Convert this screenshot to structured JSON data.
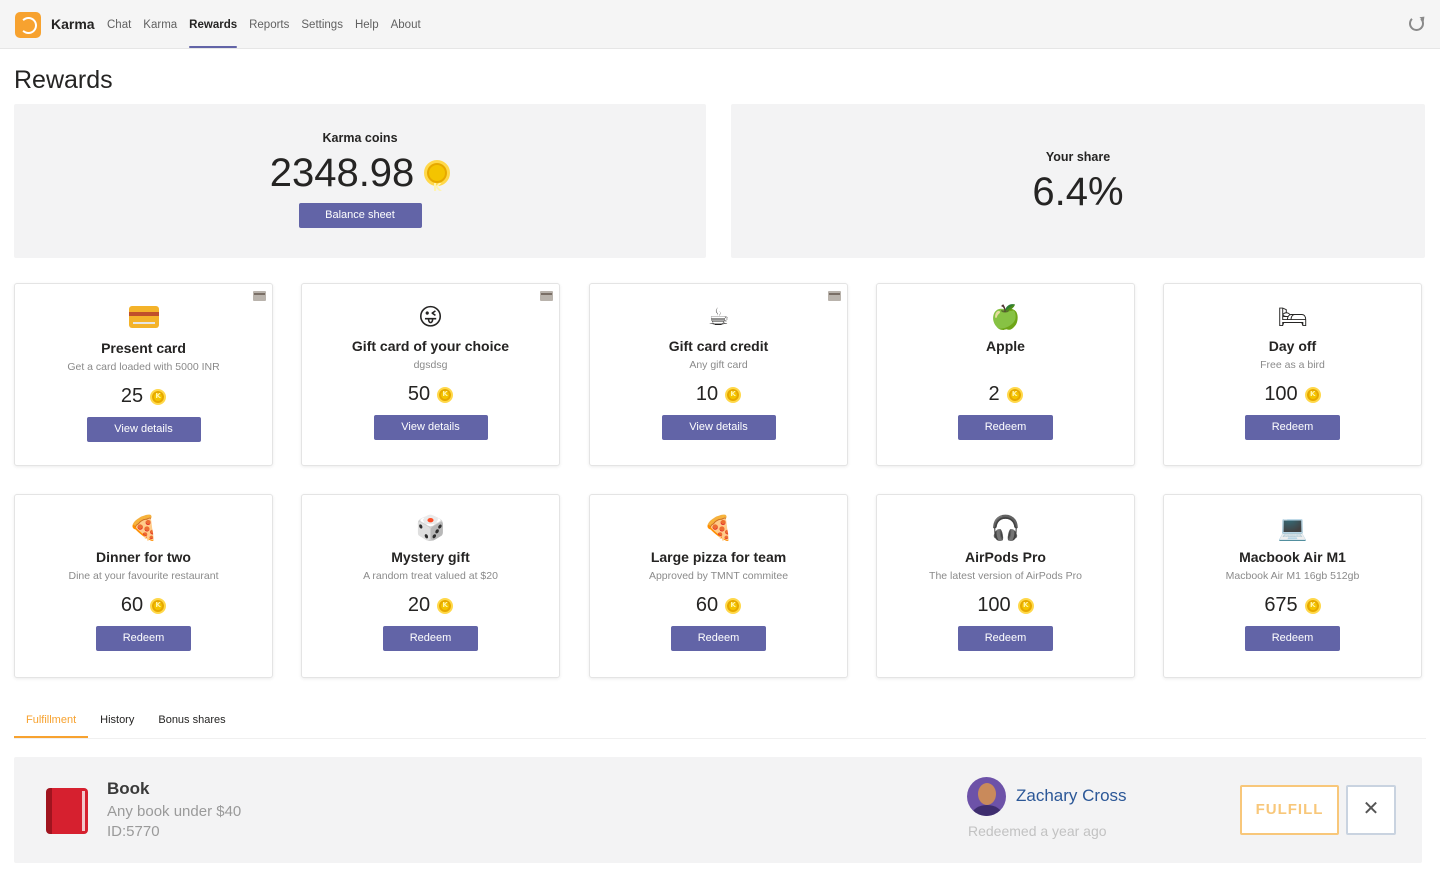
{
  "app": {
    "name": "Karma"
  },
  "nav": [
    {
      "label": "Chat",
      "active": false
    },
    {
      "label": "Karma",
      "active": false
    },
    {
      "label": "Rewards",
      "active": true
    },
    {
      "label": "Reports",
      "active": false
    },
    {
      "label": "Settings",
      "active": false
    },
    {
      "label": "Help",
      "active": false
    },
    {
      "label": "About",
      "active": false
    }
  ],
  "page": {
    "title": "Rewards"
  },
  "summary": {
    "coins_label": "Karma coins",
    "coins_value": "2348.98",
    "balance_button": "Balance sheet",
    "share_label": "Your share",
    "share_value": "6.4%"
  },
  "rewards": [
    {
      "icon": "credit-card-icon",
      "emoji": "",
      "title": "Present card",
      "desc": "Get a card loaded with 5000 INR",
      "price": "25",
      "button": "View details",
      "corner": true
    },
    {
      "icon": "winking-face-icon",
      "emoji": "😜",
      "title": "Gift card of your choice",
      "desc": "dgsdsg",
      "price": "50",
      "button": "View details",
      "corner": true
    },
    {
      "icon": "coffee-cup-icon",
      "emoji": "☕",
      "title": "Gift card credit",
      "desc": "Any gift card",
      "price": "10",
      "button": "View details",
      "corner": true
    },
    {
      "icon": "apple-icon",
      "emoji": "🍏",
      "title": "Apple",
      "desc": "",
      "price": "2",
      "button": "Redeem",
      "corner": false
    },
    {
      "icon": "bed-icon",
      "emoji": "🛏",
      "title": "Day off",
      "desc": "Free as a bird",
      "price": "100",
      "button": "Redeem",
      "corner": false
    },
    {
      "icon": "pizza-icon",
      "emoji": "🍕",
      "title": "Dinner for two",
      "desc": "Dine at your favourite restaurant",
      "price": "60",
      "button": "Redeem",
      "corner": false
    },
    {
      "icon": "dice-icon",
      "emoji": "🎲",
      "title": "Mystery gift",
      "desc": "A random treat valued at $20",
      "price": "20",
      "button": "Redeem",
      "corner": false
    },
    {
      "icon": "pizza-icon",
      "emoji": "🍕",
      "title": "Large pizza for team",
      "desc": "Approved by TMNT commitee",
      "price": "60",
      "button": "Redeem",
      "corner": false
    },
    {
      "icon": "airpods-icon",
      "emoji": "🎧",
      "title": "AirPods Pro",
      "desc": "The latest version of AirPods Pro",
      "price": "100",
      "button": "Redeem",
      "corner": false
    },
    {
      "icon": "laptop-icon",
      "emoji": "💻",
      "title": "Macbook Air M1",
      "desc": "Macbook Air M1 16gb 512gb",
      "price": "675",
      "button": "Redeem",
      "corner": false
    }
  ],
  "tabs": [
    {
      "label": "Fulfillment",
      "active": true
    },
    {
      "label": "History",
      "active": false
    },
    {
      "label": "Bonus shares",
      "active": false
    }
  ],
  "fulfillment": {
    "item_title": "Book",
    "item_desc": "Any book under $40",
    "item_id": "ID:5770",
    "user_name": "Zachary Cross",
    "redeemed": "Redeemed a year ago",
    "fulfill_button": "FULFILL",
    "close_button": "✕"
  },
  "colors": {
    "accent": "#6264a7",
    "brand": "#f7a22f",
    "coin": "#f4c400",
    "link": "#2b5797"
  }
}
